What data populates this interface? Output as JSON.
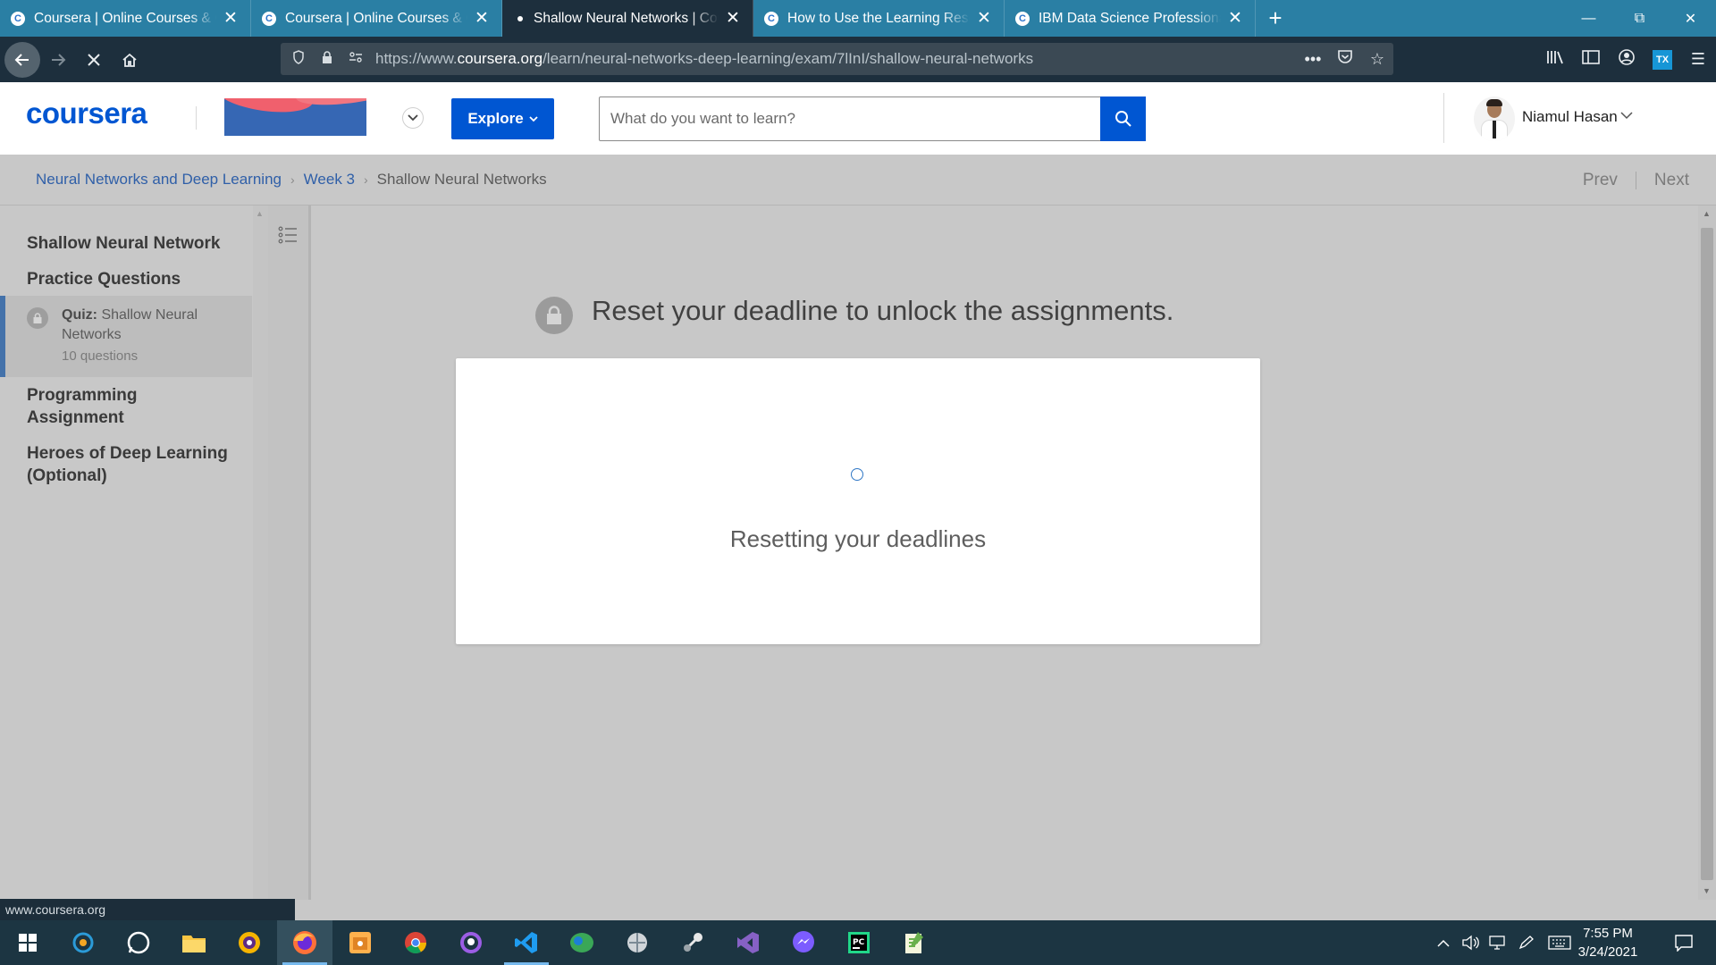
{
  "browser": {
    "tabs": [
      {
        "title": "Coursera | Online Courses & Credentials",
        "active": false
      },
      {
        "title": "Coursera | Online Courses & Credentials",
        "active": false
      },
      {
        "title": "Shallow Neural Networks | Coursera",
        "active": true
      },
      {
        "title": "How to Use the Learning Resources",
        "active": false
      },
      {
        "title": "IBM Data Science Professional Certificate",
        "active": false
      }
    ],
    "url_prefix": "https://www.",
    "url_domain": "coursera.org",
    "url_path": "/learn/neural-networks-deep-learning/exam/7lInI/shallow-neural-networks",
    "status_url": "www.coursera.org"
  },
  "header": {
    "logo": "coursera",
    "explore_label": "Explore",
    "search_placeholder": "What do you want to learn?",
    "user_name": "Niamul Hasan"
  },
  "breadcrumb": {
    "course": "Neural Networks and Deep Learning",
    "week": "Week 3",
    "current": "Shallow Neural Networks",
    "prev": "Prev",
    "next": "Next"
  },
  "sidebar": {
    "section1": "Shallow Neural Network",
    "section2": "Practice Questions",
    "quiz_label": "Quiz:",
    "quiz_title": "Shallow Neural Networks",
    "quiz_meta": "10 questions",
    "section3": "Programming Assignment",
    "section4": "Heroes of Deep Learning (Optional)"
  },
  "main": {
    "heading": "Reset your deadline to unlock the assignments.",
    "loading_text": "Resetting your deadlines"
  },
  "taskbar": {
    "time": "7:55 PM",
    "date": "3/24/2021"
  },
  "colors": {
    "coursera_blue": "#0056d2",
    "tab_bar": "#2a7fa4",
    "browser_dark": "#1d2f3d",
    "taskbar": "#1c3542"
  }
}
